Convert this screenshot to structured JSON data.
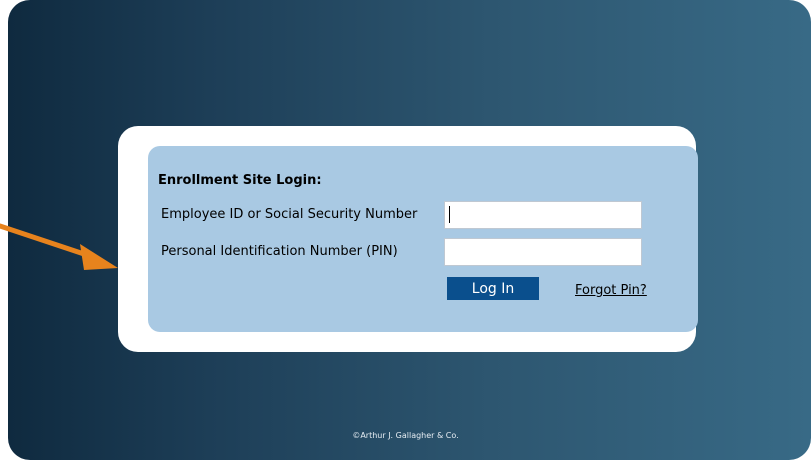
{
  "login": {
    "title": "Enrollment Site Login:",
    "employee_id_label": "Employee ID or Social Security Number",
    "employee_id_value": "",
    "pin_label": "Personal Identification Number (PIN)",
    "pin_value": "",
    "login_button": "Log In",
    "forgot_link": "Forgot Pin?"
  },
  "footer": {
    "copyright": "©Arthur J. Gallagher & Co."
  },
  "annotation": {
    "arrow_icon": "orange-arrow-icon",
    "arrow_color": "#e7831d"
  },
  "colors": {
    "form_background": "#a9c9e3",
    "button_background": "#0a4f8d",
    "page_gradient_start": "#0f2a3f",
    "page_gradient_end": "#386a86"
  }
}
